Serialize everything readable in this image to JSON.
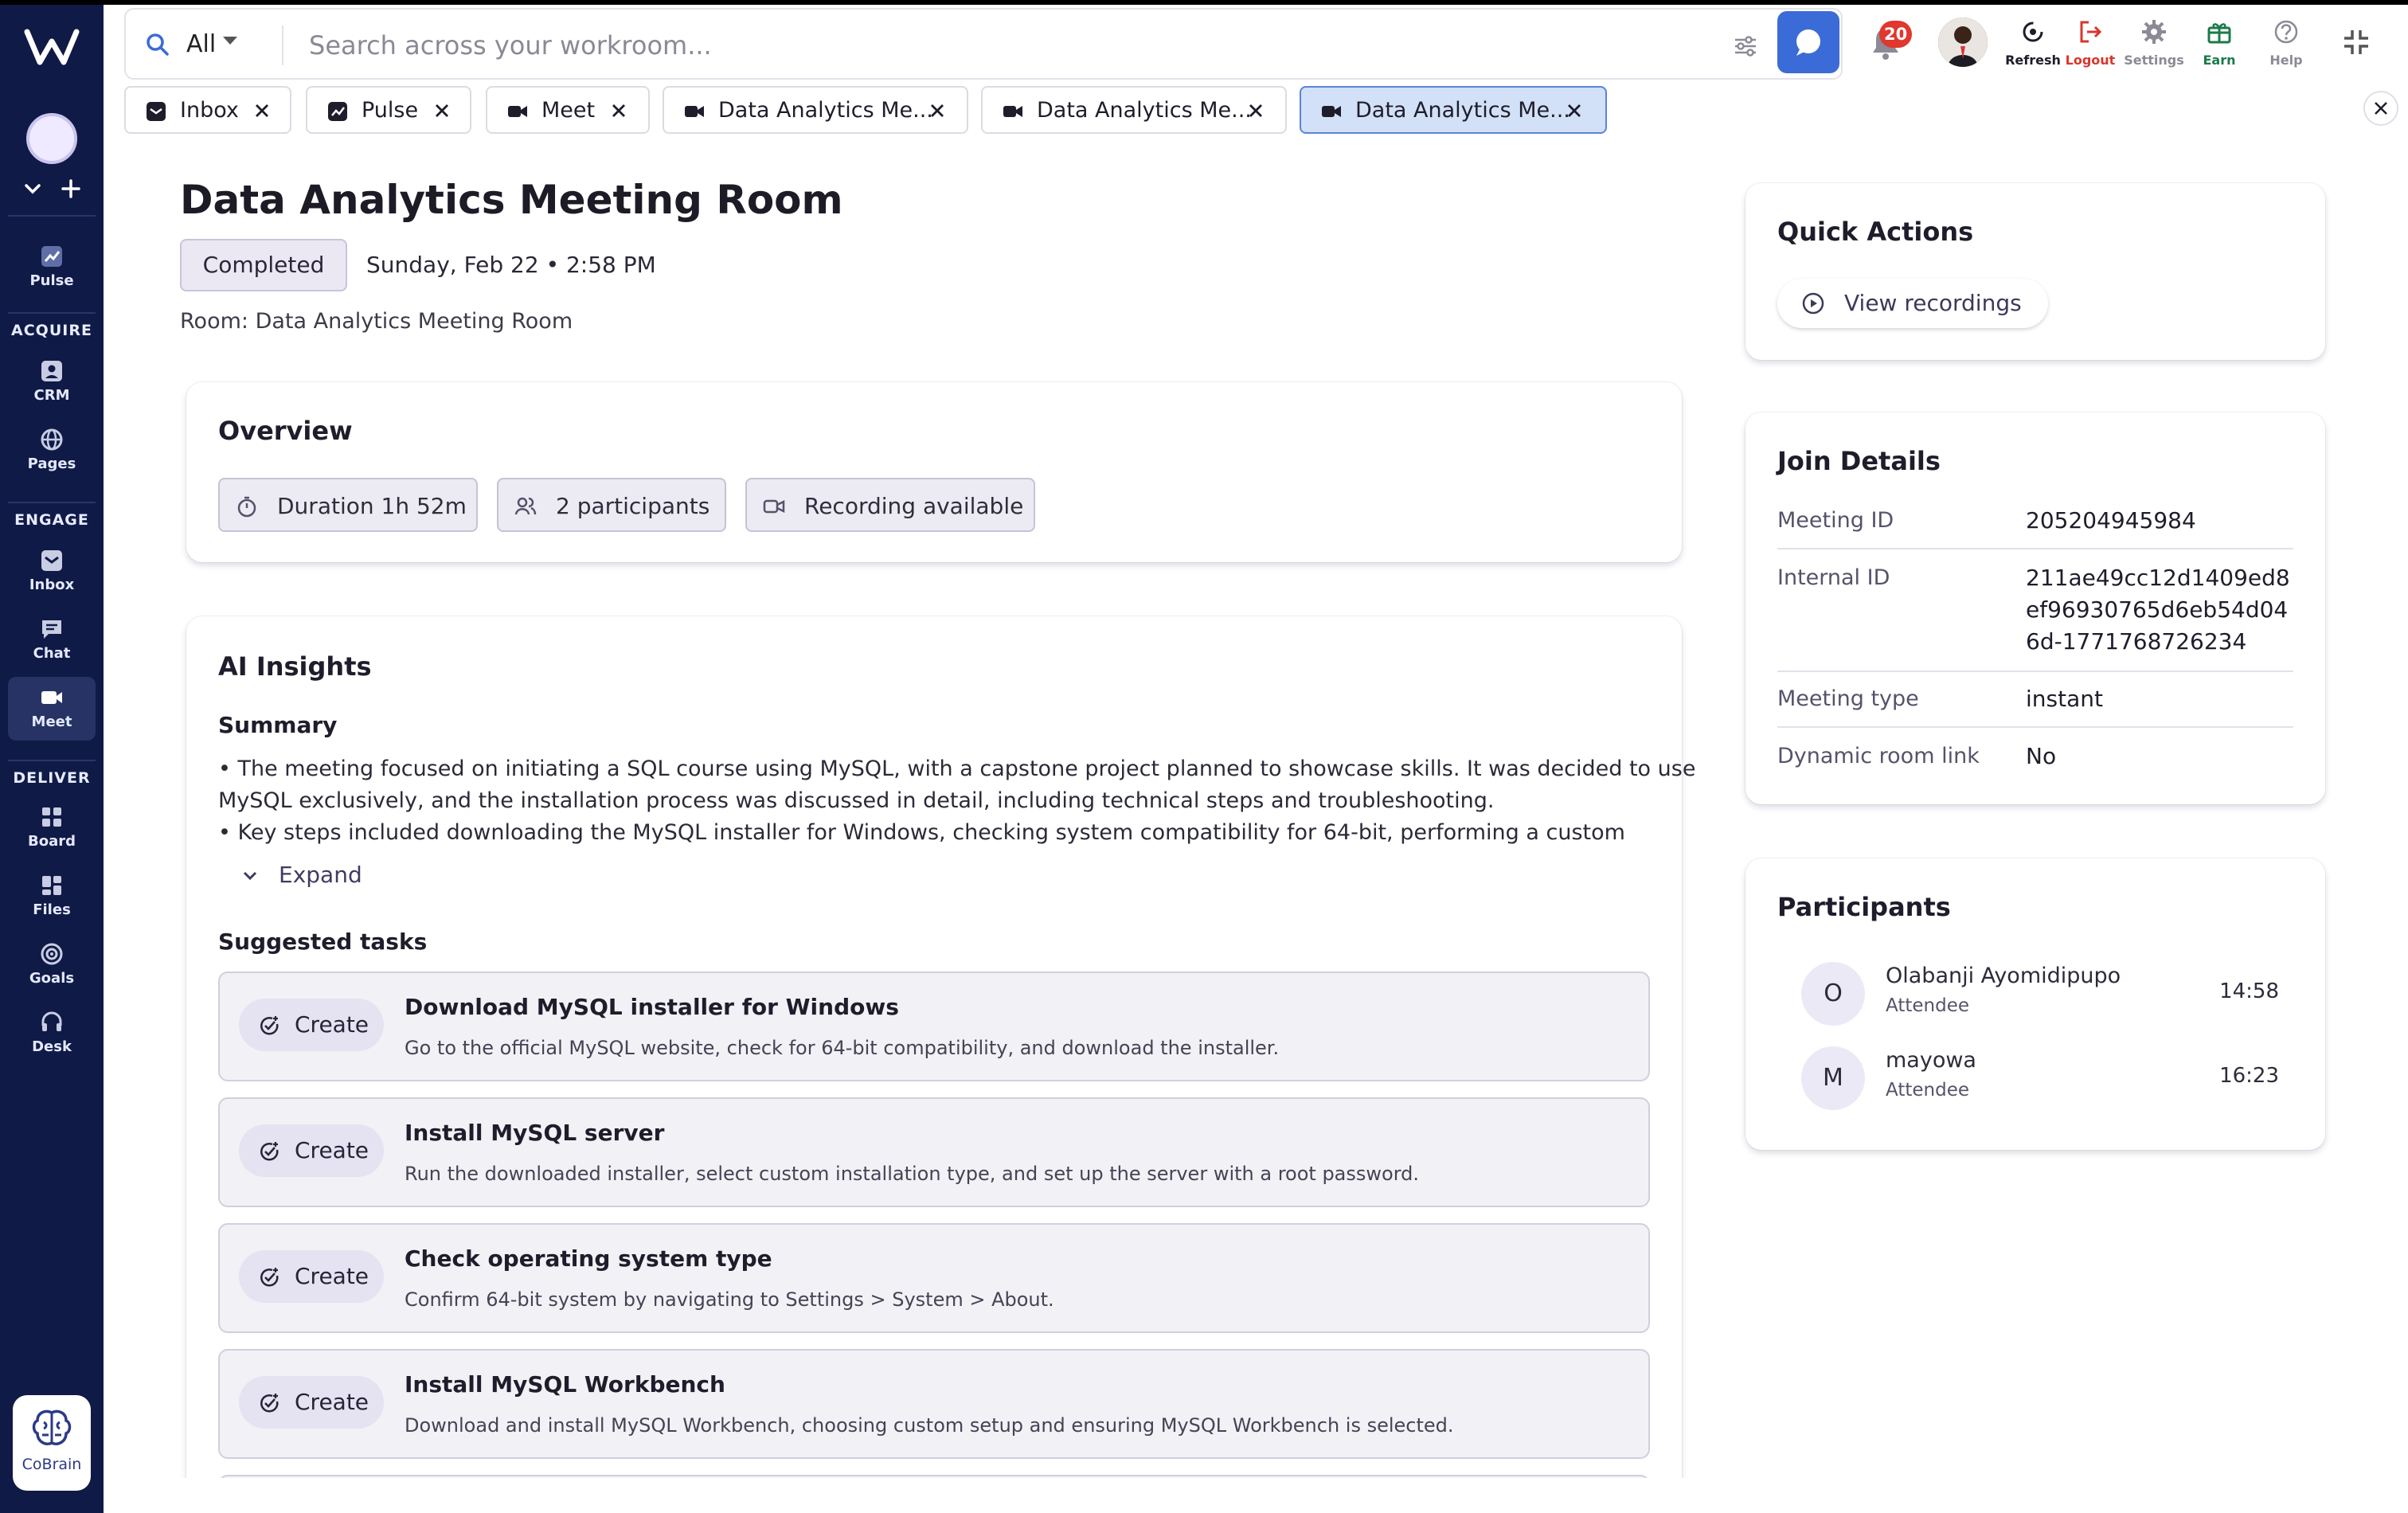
{
  "sidebar": {
    "logo": "W",
    "sections": [
      {
        "label": "ACQUIRE"
      },
      {
        "label": "ENGAGE"
      },
      {
        "label": "DELIVER"
      }
    ],
    "items": [
      {
        "label": "Pulse",
        "icon": "pulse-icon"
      },
      {
        "label": "CRM",
        "icon": "crm-icon"
      },
      {
        "label": "Pages",
        "icon": "globe-icon"
      },
      {
        "label": "Inbox",
        "icon": "inbox-icon"
      },
      {
        "label": "Chat",
        "icon": "chat-icon"
      },
      {
        "label": "Meet",
        "icon": "video-icon",
        "active": true
      },
      {
        "label": "Board",
        "icon": "board-icon"
      },
      {
        "label": "Files",
        "icon": "files-icon"
      },
      {
        "label": "Goals",
        "icon": "target-icon"
      },
      {
        "label": "Desk",
        "icon": "headset-icon"
      }
    ],
    "cobrain_label": "CoBrain"
  },
  "topbar": {
    "search_scope": "All",
    "search_placeholder": "Search across your workroom...",
    "notification_count": "20",
    "tools": [
      {
        "label": "Refresh",
        "icon": "refresh-icon",
        "color": "#1f1d2b"
      },
      {
        "label": "Logout",
        "icon": "logout-icon",
        "color": "#d9362b"
      },
      {
        "label": "Settings",
        "icon": "gear-icon",
        "color": "#8b8a96"
      },
      {
        "label": "Earn",
        "icon": "gift-icon",
        "color": "#1b7a4a"
      },
      {
        "label": "Help",
        "icon": "help-icon",
        "color": "#8b8a96"
      }
    ]
  },
  "tabs": [
    {
      "label": "Inbox",
      "icon": "inbox-icon"
    },
    {
      "label": "Pulse",
      "icon": "pulse-icon"
    },
    {
      "label": "Meet",
      "icon": "video-icon"
    },
    {
      "label": "Data Analytics Me...",
      "icon": "video-icon"
    },
    {
      "label": "Data Analytics Me...",
      "icon": "video-icon"
    },
    {
      "label": "Data Analytics Me...",
      "icon": "video-icon",
      "active": true
    }
  ],
  "meeting": {
    "title": "Data Analytics Meeting Room",
    "status": "Completed",
    "datetime": "Sunday, Feb 22 • 2:58 PM",
    "room": "Room: Data Analytics Meeting Room"
  },
  "overview": {
    "heading": "Overview",
    "chips": [
      "Duration 1h 52m",
      "2 participants",
      "Recording available"
    ]
  },
  "ai_insights": {
    "heading": "AI Insights",
    "summary_heading": "Summary",
    "summary_lines": [
      "• The meeting focused on initiating a SQL course using MySQL, with a capstone project planned to showcase skills. It was decided to use",
      "MySQL exclusively, and the installation process was discussed in detail, including technical steps and troubleshooting.",
      "• Key steps included downloading the MySQL installer for Windows, checking system compatibility for 64-bit, performing a custom"
    ],
    "expand_label": "Expand",
    "tasks_heading": "Suggested tasks",
    "create_label": "Create",
    "tasks": [
      {
        "title": "Download MySQL installer for Windows",
        "desc": "Go to the official MySQL website, check for 64-bit compatibility, and download the installer."
      },
      {
        "title": "Install MySQL server",
        "desc": "Run the downloaded installer, select custom installation type, and set up the server with a root password."
      },
      {
        "title": "Check operating system type",
        "desc": "Confirm 64-bit system by navigating to Settings > System > About."
      },
      {
        "title": "Install MySQL Workbench",
        "desc": "Download and install MySQL Workbench, choosing custom setup and ensuring MySQL Workbench is selected."
      }
    ]
  },
  "quick_actions": {
    "heading": "Quick Actions",
    "view_recordings": "View recordings"
  },
  "join_details": {
    "heading": "Join Details",
    "rows": [
      {
        "key": "Meeting ID",
        "value": "205204945984"
      },
      {
        "key": "Internal ID",
        "value": "211ae49cc12d1409ed8ef96930765d6eb54d046d-1771768726234"
      },
      {
        "key": "Meeting type",
        "value": "instant"
      },
      {
        "key": "Dynamic room link",
        "value": "No"
      }
    ]
  },
  "participants": {
    "heading": "Participants",
    "list": [
      {
        "initial": "O",
        "name": "Olabanji Ayomidipupo",
        "role": "Attendee",
        "time": "14:58"
      },
      {
        "initial": "M",
        "name": "mayowa",
        "role": "Attendee",
        "time": "16:23"
      }
    ]
  },
  "colors": {
    "sidebar_bg": "#0f1a46",
    "accent": "#3b6bd6",
    "active_tab": "#d2e1f7",
    "badge": "#e0372e"
  }
}
